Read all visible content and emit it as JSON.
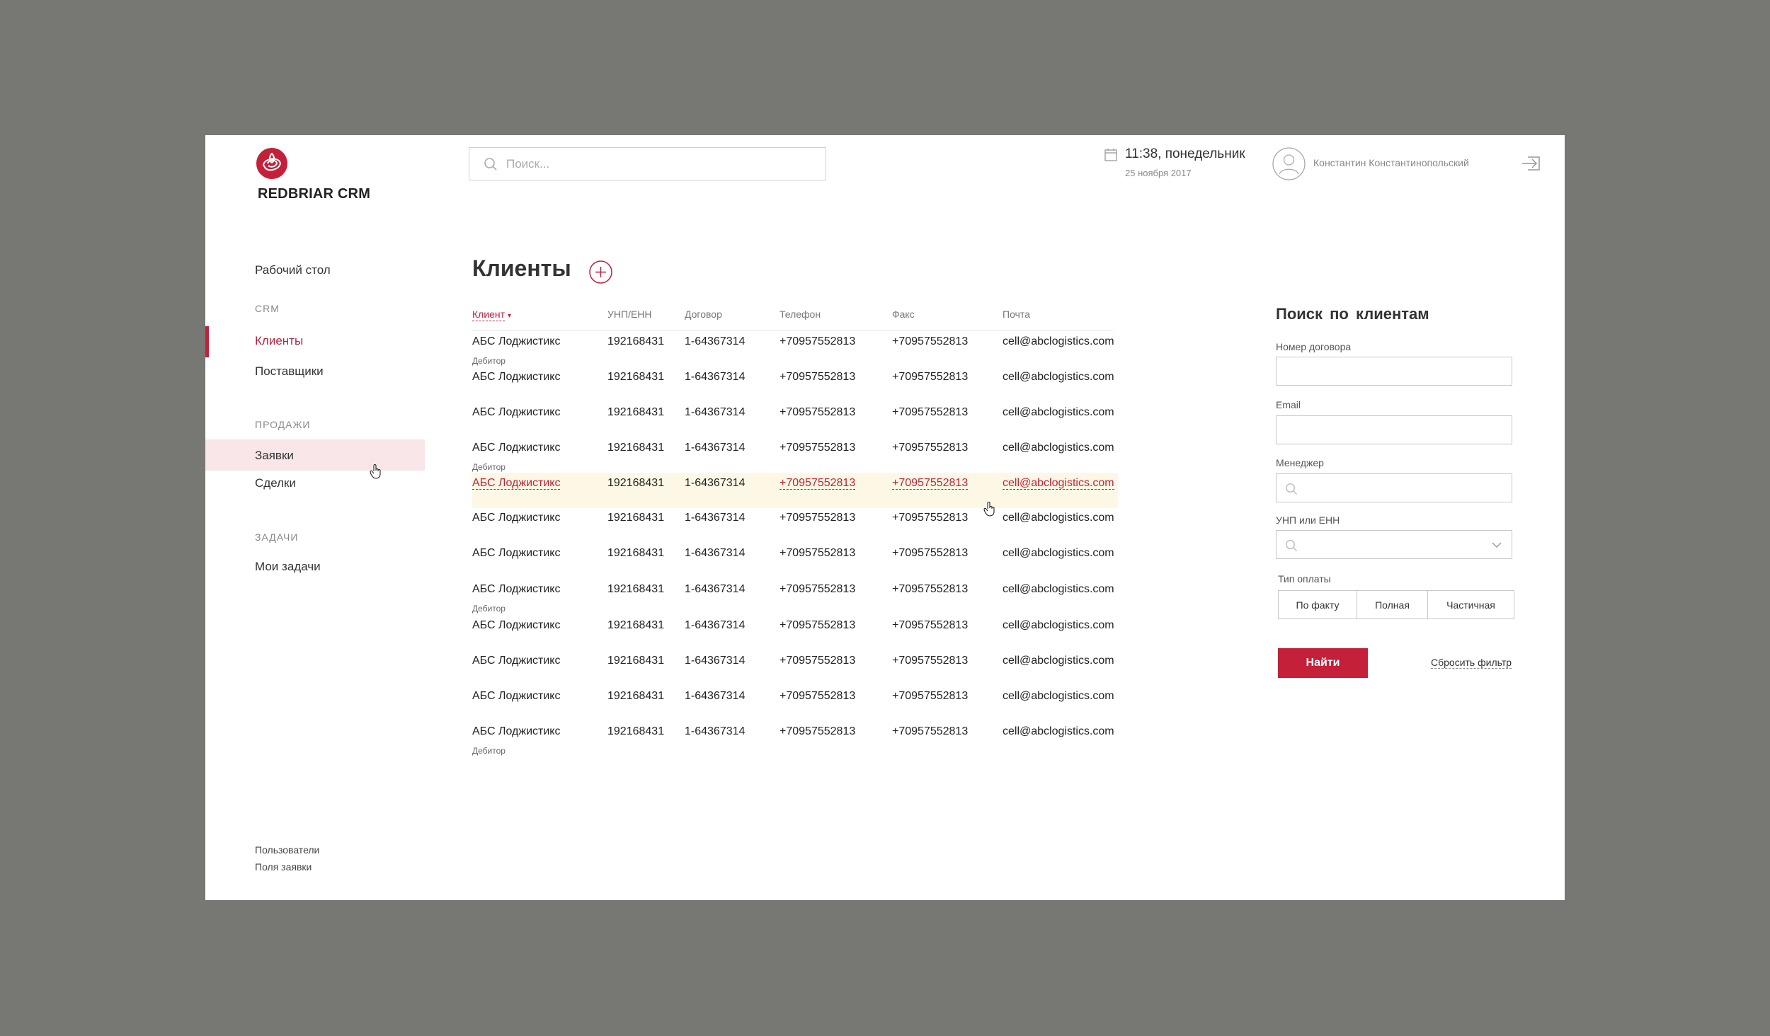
{
  "app": {
    "brand": "REDBRIAR CRM",
    "accent_color": "#c4203a"
  },
  "header": {
    "search_placeholder": "Поиск...",
    "time": "11:38, понедельник",
    "date": "25 ноября 2017",
    "user_name": "Константин Константинопольский"
  },
  "sidebar": {
    "desktop": "Рабочий стол",
    "sections": {
      "crm": "CRM",
      "sales": "ПРОДАЖИ",
      "tasks": "ЗАДАЧИ"
    },
    "items": {
      "clients": "Клиенты",
      "suppliers": "Поставщики",
      "requests": "Заявки",
      "deals": "Сделки",
      "my_tasks": "Мои задачи"
    },
    "footer": {
      "users": "Пользователи",
      "request_fields": "Поля заявки"
    }
  },
  "main": {
    "title": "Клиенты",
    "columns": {
      "client": "Клиент",
      "unp": "УНП/ЕНН",
      "contract": "Договор",
      "phone": "Телефон",
      "fax": "Факс",
      "email": "Почта"
    },
    "rows": [
      {
        "client": "АБС Лоджистикс",
        "note": "Дебитор",
        "unp": "192168431",
        "contract": "1-64367314",
        "phone": "+70957552813",
        "fax": "+70957552813",
        "email": "cell@abclogistics.com"
      },
      {
        "client": "АБС Лоджистикс",
        "note": "",
        "unp": "192168431",
        "contract": "1-64367314",
        "phone": "+70957552813",
        "fax": "+70957552813",
        "email": "cell@abclogistics.com"
      },
      {
        "client": "АБС Лоджистикс",
        "note": "",
        "unp": "192168431",
        "contract": "1-64367314",
        "phone": "+70957552813",
        "fax": "+70957552813",
        "email": "cell@abclogistics.com"
      },
      {
        "client": "АБС Лоджистикс",
        "note": "Дебитор",
        "unp": "192168431",
        "contract": "1-64367314",
        "phone": "+70957552813",
        "fax": "+70957552813",
        "email": "cell@abclogistics.com"
      },
      {
        "client": "АБС Лоджистикс",
        "note": "",
        "unp": "192168431",
        "contract": "1-64367314",
        "phone": "+70957552813",
        "fax": "+70957552813",
        "email": "cell@abclogistics.com",
        "highlighted": true
      },
      {
        "client": "АБС Лоджистикс",
        "note": "",
        "unp": "192168431",
        "contract": "1-64367314",
        "phone": "+70957552813",
        "fax": "+70957552813",
        "email": "cell@abclogistics.com"
      },
      {
        "client": "АБС Лоджистикс",
        "note": "",
        "unp": "192168431",
        "contract": "1-64367314",
        "phone": "+70957552813",
        "fax": "+70957552813",
        "email": "cell@abclogistics.com"
      },
      {
        "client": "АБС Лоджистикс",
        "note": "Дебитор",
        "unp": "192168431",
        "contract": "1-64367314",
        "phone": "+70957552813",
        "fax": "+70957552813",
        "email": "cell@abclogistics.com"
      },
      {
        "client": "АБС Лоджистикс",
        "note": "",
        "unp": "192168431",
        "contract": "1-64367314",
        "phone": "+70957552813",
        "fax": "+70957552813",
        "email": "cell@abclogistics.com"
      },
      {
        "client": "АБС Лоджистикс",
        "note": "",
        "unp": "192168431",
        "contract": "1-64367314",
        "phone": "+70957552813",
        "fax": "+70957552813",
        "email": "cell@abclogistics.com"
      },
      {
        "client": "АБС Лоджистикс",
        "note": "",
        "unp": "192168431",
        "contract": "1-64367314",
        "phone": "+70957552813",
        "fax": "+70957552813",
        "email": "cell@abclogistics.com"
      },
      {
        "client": "АБС Лоджистикс",
        "note": "Дебитор",
        "unp": "192168431",
        "contract": "1-64367314",
        "phone": "+70957552813",
        "fax": "+70957552813",
        "email": "cell@abclogistics.com"
      }
    ]
  },
  "filter": {
    "title": "Поиск по клиентам",
    "contract_label": "Номер договора",
    "email_label": "Email",
    "manager_label": "Менеджер",
    "unp_label": "УНП или ЕНН",
    "payment_label": "Тип оплаты",
    "payment_options": [
      "По факту",
      "Полная",
      "Частичная"
    ],
    "find_button": "Найти",
    "reset_link": "Сбросить фильтр"
  }
}
